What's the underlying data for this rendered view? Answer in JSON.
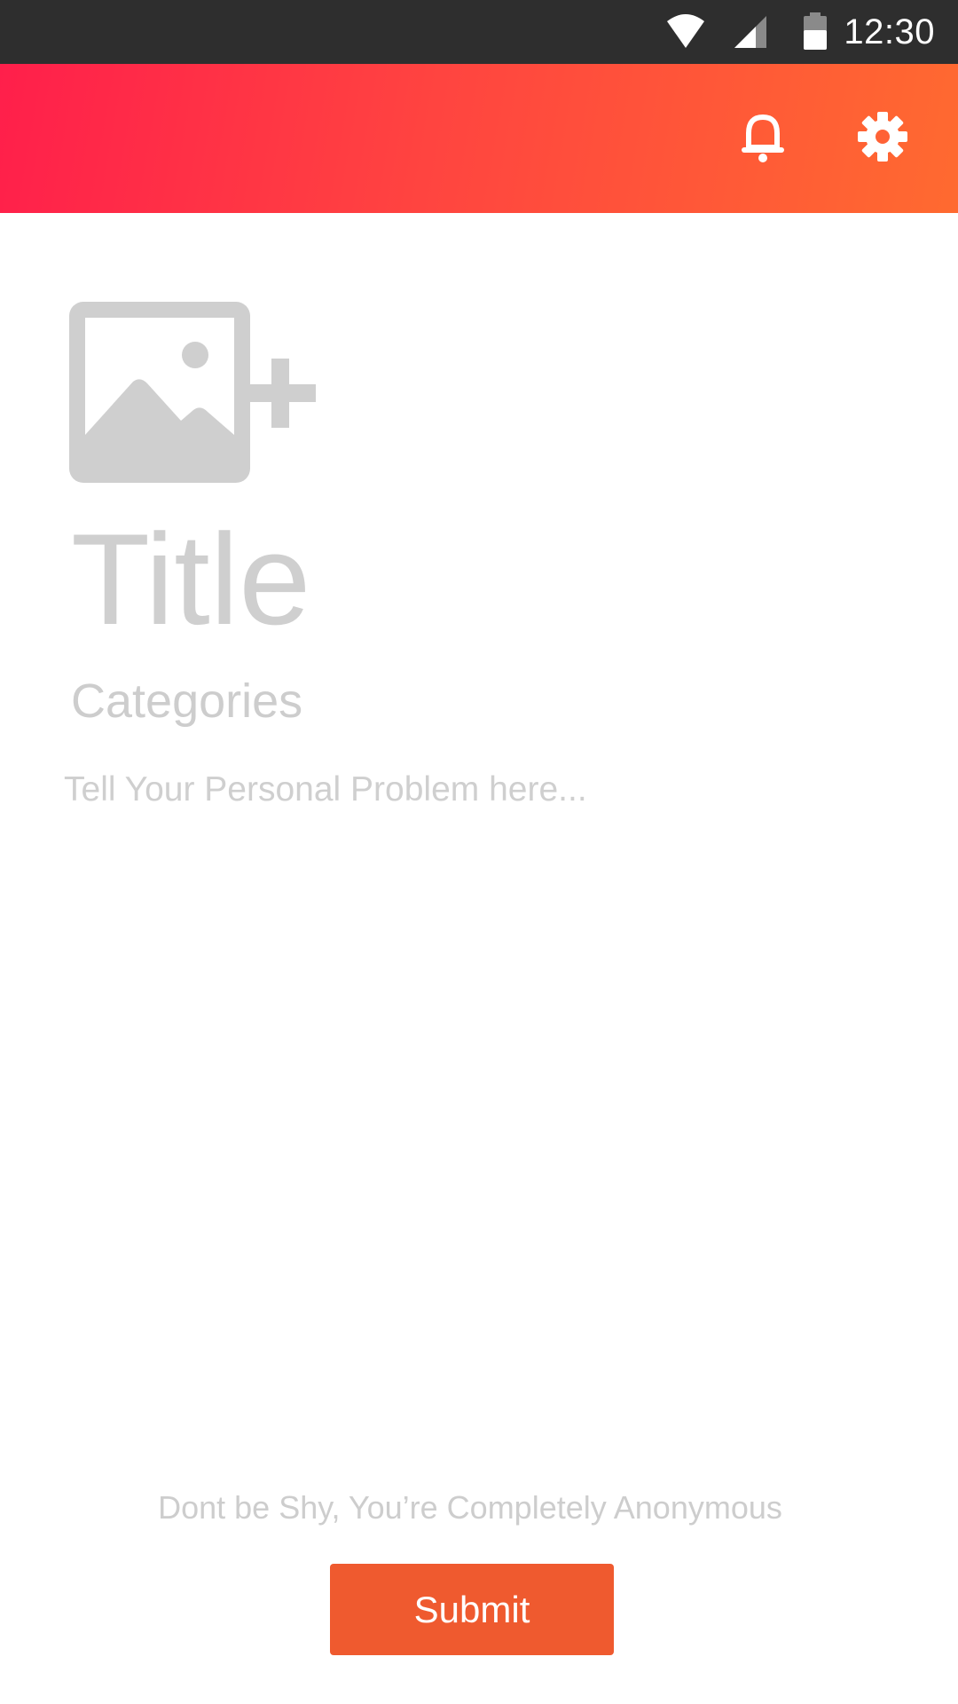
{
  "status_bar": {
    "time": "12:30",
    "icons": [
      "wifi-icon",
      "cellular-signal-icon",
      "battery-icon"
    ],
    "background": "#2e2e2e"
  },
  "app_bar": {
    "gradient_colors": [
      "#ff1f4b",
      "#ff6a30"
    ],
    "actions": [
      "bell-icon",
      "gear-icon"
    ]
  },
  "form": {
    "add_image_icon": "add-image-icon",
    "title_placeholder": "Title",
    "categories_placeholder": "Categories",
    "problem_placeholder": "Tell Your Personal Problem here...",
    "placeholder_color": "#cfcfcf"
  },
  "footer": {
    "anonymous_note": "Dont be Shy, You’re Completely Anonymous",
    "submit_label": "Submit",
    "submit_color": "#ef5a2f"
  }
}
